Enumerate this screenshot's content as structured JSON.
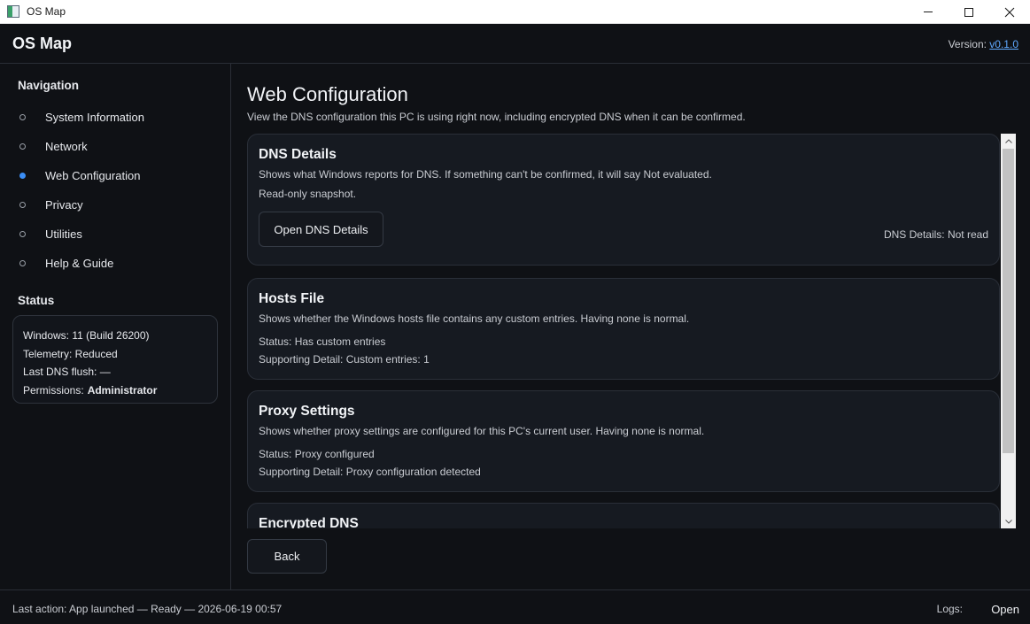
{
  "window": {
    "title": "OS Map"
  },
  "header": {
    "app_title": "OS Map",
    "version_label": "Version:",
    "version_link": "v0.1.0"
  },
  "sidebar": {
    "nav_heading": "Navigation",
    "items": [
      {
        "label": "System Information",
        "active": false
      },
      {
        "label": "Network",
        "active": false
      },
      {
        "label": "Web Configuration",
        "active": true
      },
      {
        "label": "Privacy",
        "active": false
      },
      {
        "label": "Utilities",
        "active": false
      },
      {
        "label": "Help & Guide",
        "active": false
      }
    ],
    "status_heading": "Status",
    "status": {
      "windows": "Windows: 11 (Build 26200)",
      "telemetry": "Telemetry: Reduced",
      "dns_flush": "Last DNS flush: —",
      "permissions_label": "Permissions:",
      "permissions_value": "Administrator"
    }
  },
  "main": {
    "title": "Web Configuration",
    "description": "View the DNS configuration this PC is using right now, including encrypted DNS when it can be confirmed.",
    "cards": {
      "dns": {
        "title": "DNS Details",
        "subtitle": "Shows what Windows reports for DNS. If something can't be confirmed, it will say Not evaluated.",
        "note": "Read-only snapshot.",
        "button": "Open DNS Details",
        "status": "DNS Details: Not read"
      },
      "hosts": {
        "title": "Hosts File",
        "subtitle": "Shows whether the Windows hosts file contains any custom entries. Having none is normal.",
        "status": "Status: Has custom entries",
        "detail": "Supporting Detail: Custom entries: 1"
      },
      "proxy": {
        "title": "Proxy Settings",
        "subtitle": "Shows whether proxy settings are configured for this PC's current user. Having none is normal.",
        "status": "Status: Proxy configured",
        "detail": "Supporting Detail: Proxy configuration detected"
      },
      "encrypted": {
        "title": "Encrypted DNS"
      }
    },
    "back_button": "Back"
  },
  "footer": {
    "last_action": "Last action: App launched — Ready — 2026-06-19 00:57",
    "logs_label": "Logs:",
    "logs_open": "Open"
  },
  "colors": {
    "accent": "#3b8ef6",
    "link": "#5fa8ff",
    "background": "#0f1115",
    "card": "#161a21"
  }
}
